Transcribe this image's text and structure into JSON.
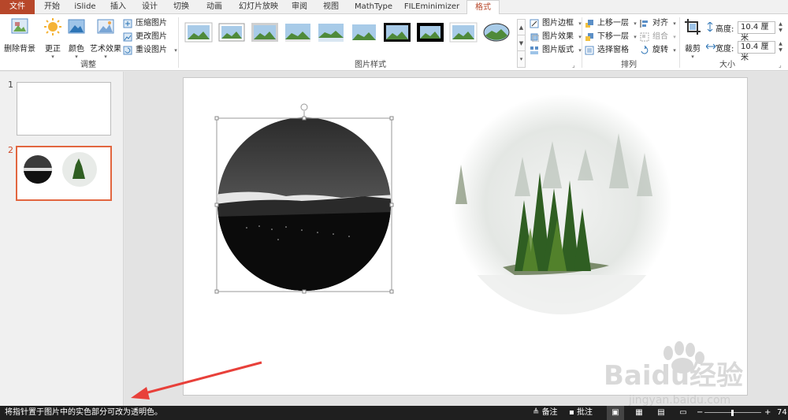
{
  "tabs": [
    "文件",
    "开始",
    "iSlide",
    "插入",
    "设计",
    "切换",
    "动画",
    "幻灯片放映",
    "审阅",
    "视图",
    "MathType",
    "FILEminimizer",
    "格式"
  ],
  "active_tab": "格式",
  "ribbon": {
    "adjust": {
      "remove_bg": "删除背景",
      "corrections": "更正",
      "color": "颜色",
      "artistic": "艺术效果",
      "compress": "压缩图片",
      "change": "更改图片",
      "reset": "重设图片",
      "label": "调整"
    },
    "picture_styles": {
      "border": "图片边框",
      "effects": "图片效果",
      "layout": "图片版式",
      "label": "图片样式"
    },
    "arrange": {
      "bring_forward": "上移一层",
      "send_backward": "下移一层",
      "selection_pane": "选择窗格",
      "align": "对齐",
      "group": "组合",
      "rotate": "旋转",
      "label": "排列"
    },
    "size": {
      "crop": "裁剪",
      "height_label": "高度:",
      "height_value": "10.4 厘米",
      "width_label": "宽度:",
      "width_value": "10.4 厘米",
      "label": "大小"
    }
  },
  "slides": [
    {
      "number": "1"
    },
    {
      "number": "2"
    }
  ],
  "status": {
    "hint": "将指针置于图片中的实色部分可改为透明色。",
    "notes": "备注",
    "comments": "批注",
    "zoom": "74"
  },
  "watermark": {
    "brand": "Baidu经验",
    "url": "jingyan.baidu.com"
  },
  "colors": {
    "file_tab": "#b7472a",
    "accent": "#b7472a",
    "selection_border": "#e2663f",
    "status_bar": "#1f1f1f",
    "annotation_arrow": "#e8403a"
  }
}
